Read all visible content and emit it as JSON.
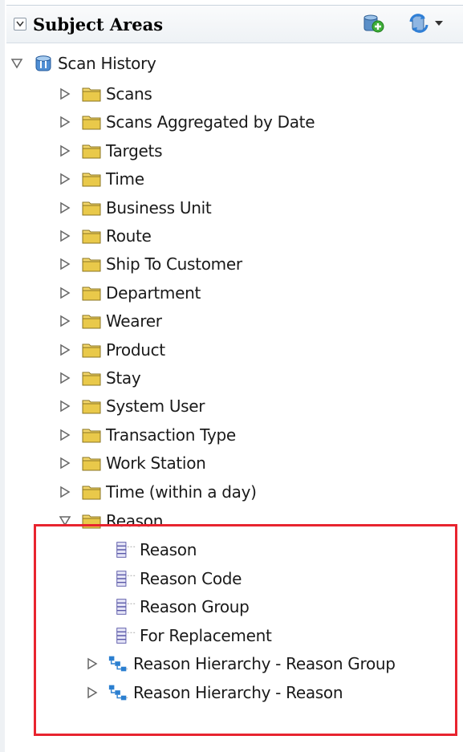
{
  "header": {
    "title": "Subject Areas",
    "icons": [
      "collapse-toggle-icon",
      "new-subject-area-icon",
      "refresh-icon",
      "chevron-down-icon"
    ]
  },
  "tree": {
    "root": {
      "label": "Scan History",
      "icon": "subject-area-icon",
      "expanded": true
    },
    "folders": [
      "Scans",
      "Scans Aggregated by Date",
      "Targets",
      "Time",
      "Business Unit",
      "Route",
      "Ship To Customer",
      "Department",
      "Wearer",
      "Product",
      "Stay",
      "System User",
      "Transaction Type",
      "Work Station",
      "Time (within a day)"
    ],
    "reason_folder": {
      "label": "Reason",
      "expanded": true,
      "columns": [
        "Reason",
        "Reason Code",
        "Reason Group",
        "For Replacement"
      ],
      "hierarchies": [
        "Reason Hierarchy - Reason Group",
        "Reason Hierarchy - Reason"
      ]
    }
  },
  "colors": {
    "highlight": "#e8242f",
    "folder": "#e9c94a",
    "hierarchy": "#2b7fd0",
    "column": "#6a68b8"
  }
}
